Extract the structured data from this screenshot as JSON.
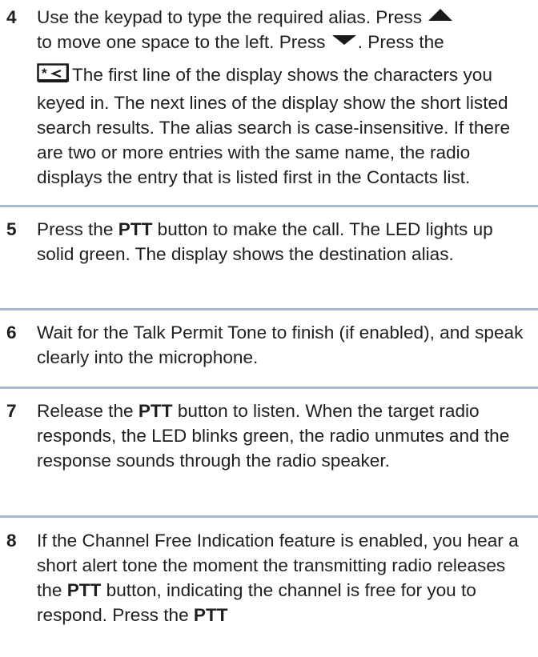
{
  "steps": [
    {
      "number": "4",
      "l1": "Use the keypad to type the required alias. Press",
      "l1b": "to move one space to the left. Press",
      "l1c": ". Press the",
      "l2_icon": "star-backspace-key-icon",
      "l2": "The first line of the display shows the characters you keyed in. The next lines of the display show the short listed search results. The alias search is case-insensitive. If there are two or more entries with the same name, the radio displays the entry that is listed first in the Contacts list."
    },
    {
      "number": "5",
      "pre": "Press the ",
      "bold": "PTT",
      "post": " button to make the call. The LED lights up solid green. The display shows the destination alias."
    },
    {
      "number": "6",
      "text": "Wait for the Talk Permit Tone to finish (if enabled), and speak clearly into the microphone."
    },
    {
      "number": "7",
      "pre": "Release the ",
      "bold": "PTT",
      "post": " button to listen. When the target radio responds, the LED blinks green, the radio unmutes and the response sounds through the radio speaker."
    },
    {
      "number": "8",
      "pre": "If the Channel Free Indication feature is enabled, you hear a short alert tone the moment the transmitting radio releases the ",
      "bold": "PTT",
      "mid": " button, indicating the channel is free for you to respond. Press the ",
      "bold2": "PTT"
    }
  ],
  "icons": {
    "up": "up-arrow-icon",
    "down": "down-arrow-icon",
    "key": "star-backspace-key-icon"
  },
  "colors": {
    "divider": "#a7b8cf",
    "text": "#1f1f1f"
  }
}
